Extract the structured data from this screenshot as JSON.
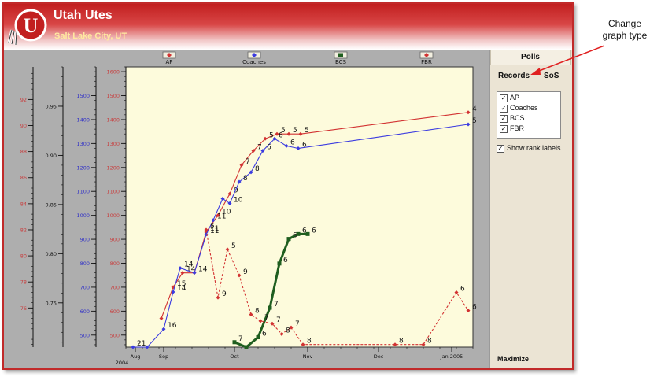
{
  "app": {
    "title": "Utah Utes",
    "subtitle": "Salt Lake City, UT",
    "logo_letter": "U"
  },
  "side_panel": {
    "tab_polls": "Polls",
    "tab_records": "Records",
    "tab_sos": "SoS",
    "checkboxes": [
      {
        "label": "AP",
        "checked": true
      },
      {
        "label": "Coaches",
        "checked": true
      },
      {
        "label": "BCS",
        "checked": true
      },
      {
        "label": "FBR",
        "checked": true
      }
    ],
    "show_rank_labels": {
      "label": "Show rank labels",
      "checked": true
    },
    "maximize": "Maximize"
  },
  "annotation": {
    "text_line1": "Change",
    "text_line2": "graph type",
    "arrow_color": "#e02020"
  },
  "colors": {
    "ap": "#d23232",
    "coaches": "#3b3be0",
    "bcs": "#1f5e1f",
    "fbr": "#d23232",
    "axis_red": "#c84040",
    "axis_blue": "#3030c8",
    "plot_bg": "#fdfbdc"
  },
  "chart_data": {
    "type": "line",
    "legend": [
      {
        "name": "AP",
        "color": "#d23232",
        "marker": "diamond"
      },
      {
        "name": "Coaches",
        "color": "#3b3be0",
        "marker": "diamond"
      },
      {
        "name": "BCS",
        "color": "#1f5e1f",
        "marker": "square"
      },
      {
        "name": "FBR",
        "color": "#d23232",
        "marker": "diamond"
      }
    ],
    "x_ticks": [
      "Aug",
      "Sep",
      "Oct",
      "Nov",
      "Dec",
      "Jan 2005"
    ],
    "x_extra_label": "2004",
    "x_range": [
      "2004-08-16",
      "2005-01-10"
    ],
    "y_axes": [
      {
        "name": "main",
        "color": "#c84040",
        "range": [
          450,
          1620
        ],
        "ticks": [
          500,
          600,
          700,
          800,
          900,
          1000,
          1100,
          1200,
          1300,
          1400,
          1500,
          1600
        ]
      },
      {
        "name": "blue",
        "color": "#3030c8",
        "range": [
          450,
          1620
        ],
        "ticks": [
          500,
          600,
          700,
          800,
          900,
          1000,
          1100,
          1200,
          1300,
          1400,
          1500
        ]
      },
      {
        "name": "index",
        "color": "#111111",
        "range": [
          0.705,
          0.99
        ],
        "ticks": [
          0.75,
          0.8,
          0.85,
          0.9,
          0.95
        ]
      },
      {
        "name": "fbr",
        "color": "#c84040",
        "range": [
          73,
          94.5
        ],
        "ticks": [
          76,
          78,
          80,
          82,
          84,
          86,
          88,
          90,
          92
        ]
      }
    ],
    "series": [
      {
        "name": "AP",
        "color": "#d23232",
        "dashed": false,
        "points": [
          {
            "date": "2004-08-31",
            "y": 570,
            "rank": ""
          },
          {
            "date": "2004-09-05",
            "y": 700,
            "rank": "15"
          },
          {
            "date": "2004-09-09",
            "y": 760,
            "rank": "14"
          },
          {
            "date": "2004-09-14",
            "y": 760,
            "rank": "14"
          },
          {
            "date": "2004-09-19",
            "y": 930,
            "rank": "11"
          },
          {
            "date": "2004-09-24",
            "y": 1000,
            "rank": "10"
          },
          {
            "date": "2004-09-29",
            "y": 1090,
            "rank": "9"
          },
          {
            "date": "2004-10-04",
            "y": 1210,
            "rank": "7"
          },
          {
            "date": "2004-10-09",
            "y": 1270,
            "rank": "7"
          },
          {
            "date": "2004-10-14",
            "y": 1320,
            "rank": "5"
          },
          {
            "date": "2004-10-19",
            "y": 1340,
            "rank": "5"
          },
          {
            "date": "2004-10-24",
            "y": 1340,
            "rank": "5"
          },
          {
            "date": "2004-10-29",
            "y": 1340,
            "rank": "5"
          },
          {
            "date": "2005-01-08",
            "y": 1430,
            "rank": "4"
          }
        ]
      },
      {
        "name": "Coaches",
        "color": "#3b3be0",
        "dashed": false,
        "points": [
          {
            "date": "2004-08-19",
            "y": 450,
            "rank": "21"
          },
          {
            "date": "2004-08-25",
            "y": 450,
            "rank": ""
          },
          {
            "date": "2004-09-01",
            "y": 525,
            "rank": "16"
          },
          {
            "date": "2004-09-05",
            "y": 680,
            "rank": "14"
          },
          {
            "date": "2004-09-08",
            "y": 780,
            "rank": "14"
          },
          {
            "date": "2004-09-14",
            "y": 760,
            "rank": ""
          },
          {
            "date": "2004-09-19",
            "y": 920,
            "rank": "11"
          },
          {
            "date": "2004-09-22",
            "y": 980,
            "rank": "11"
          },
          {
            "date": "2004-09-26",
            "y": 1070,
            "rank": ""
          },
          {
            "date": "2004-09-29",
            "y": 1050,
            "rank": "10"
          },
          {
            "date": "2004-10-03",
            "y": 1140,
            "rank": "8"
          },
          {
            "date": "2004-10-08",
            "y": 1180,
            "rank": "8"
          },
          {
            "date": "2004-10-13",
            "y": 1270,
            "rank": "6"
          },
          {
            "date": "2004-10-18",
            "y": 1320,
            "rank": "6"
          },
          {
            "date": "2004-10-23",
            "y": 1290,
            "rank": "6"
          },
          {
            "date": "2004-10-28",
            "y": 1280,
            "rank": "6"
          },
          {
            "date": "2005-01-08",
            "y": 1380,
            "rank": "5"
          }
        ]
      },
      {
        "name": "BCS",
        "color": "#1f5e1f",
        "dashed": false,
        "points": [
          {
            "date": "2004-10-01",
            "y": 0.71,
            "rank": "7"
          },
          {
            "date": "2004-10-06",
            "y": 0.705,
            "rank": ""
          },
          {
            "date": "2004-10-11",
            "y": 0.715,
            "rank": "6"
          },
          {
            "date": "2004-10-16",
            "y": 0.745,
            "rank": "7"
          },
          {
            "date": "2004-10-20",
            "y": 0.79,
            "rank": "6"
          },
          {
            "date": "2004-10-24",
            "y": 0.815,
            "rank": "6"
          },
          {
            "date": "2004-10-28",
            "y": 0.82,
            "rank": "6"
          },
          {
            "date": "2004-11-01",
            "y": 0.82,
            "rank": "6"
          }
        ]
      },
      {
        "name": "FBR",
        "color": "#d23232",
        "dashed": true,
        "points": [
          {
            "date": "2004-09-19",
            "y": 82,
            "rank": "5"
          },
          {
            "date": "2004-09-24",
            "y": 76.8,
            "rank": "9"
          },
          {
            "date": "2004-09-28",
            "y": 80.5,
            "rank": "5"
          },
          {
            "date": "2004-10-03",
            "y": 78.5,
            "rank": "9"
          },
          {
            "date": "2004-10-08",
            "y": 75.5,
            "rank": "8"
          },
          {
            "date": "2004-10-12",
            "y": 75.0,
            "rank": "7"
          },
          {
            "date": "2004-10-17",
            "y": 74.8,
            "rank": "7"
          },
          {
            "date": "2004-10-21",
            "y": 74.0,
            "rank": "8"
          },
          {
            "date": "2004-10-25",
            "y": 74.5,
            "rank": "7"
          },
          {
            "date": "2004-10-30",
            "y": 73.2,
            "rank": "8"
          },
          {
            "date": "2004-12-08",
            "y": 73.2,
            "rank": "8"
          },
          {
            "date": "2004-12-20",
            "y": 73.2,
            "rank": "8"
          },
          {
            "date": "2005-01-03",
            "y": 77.2,
            "rank": "6"
          },
          {
            "date": "2005-01-08",
            "y": 75.8,
            "rank": "6"
          }
        ]
      }
    ]
  }
}
